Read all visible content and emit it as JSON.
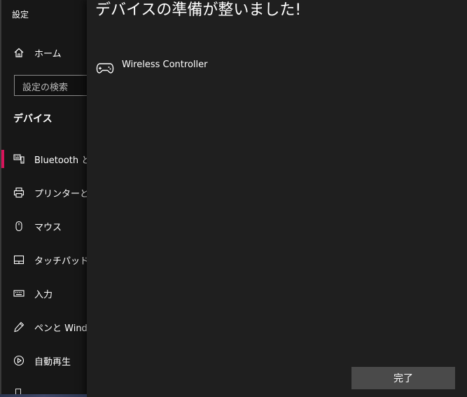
{
  "settings": {
    "title": "設定",
    "home_label": "ホーム",
    "search_placeholder": "設定の検索",
    "section_heading": "デバイス",
    "nav_items": [
      {
        "label": "Bluetooth とその他のデバイス",
        "icon": "bluetooth-devices-icon",
        "selected": true
      },
      {
        "label": "プリンターとスキャナー",
        "icon": "printer-icon",
        "selected": false
      },
      {
        "label": "マウス",
        "icon": "mouse-icon",
        "selected": false
      },
      {
        "label": "タッチパッド",
        "icon": "touchpad-icon",
        "selected": false
      },
      {
        "label": "入力",
        "icon": "keyboard-icon",
        "selected": false
      },
      {
        "label": "ペンと Windows Ink",
        "icon": "pen-icon",
        "selected": false
      },
      {
        "label": "自動再生",
        "icon": "autoplay-icon",
        "selected": false
      }
    ]
  },
  "dialog": {
    "title": "デバイスの準備が整いました!",
    "device_name": "Wireless Controller",
    "device_icon": "gamepad-icon",
    "done_label": "完了"
  },
  "colors": {
    "accent": "#d6145a",
    "pane_bg": "#171717",
    "dialog_bg": "#1f1f1f",
    "button_bg": "#4a4a4a"
  }
}
